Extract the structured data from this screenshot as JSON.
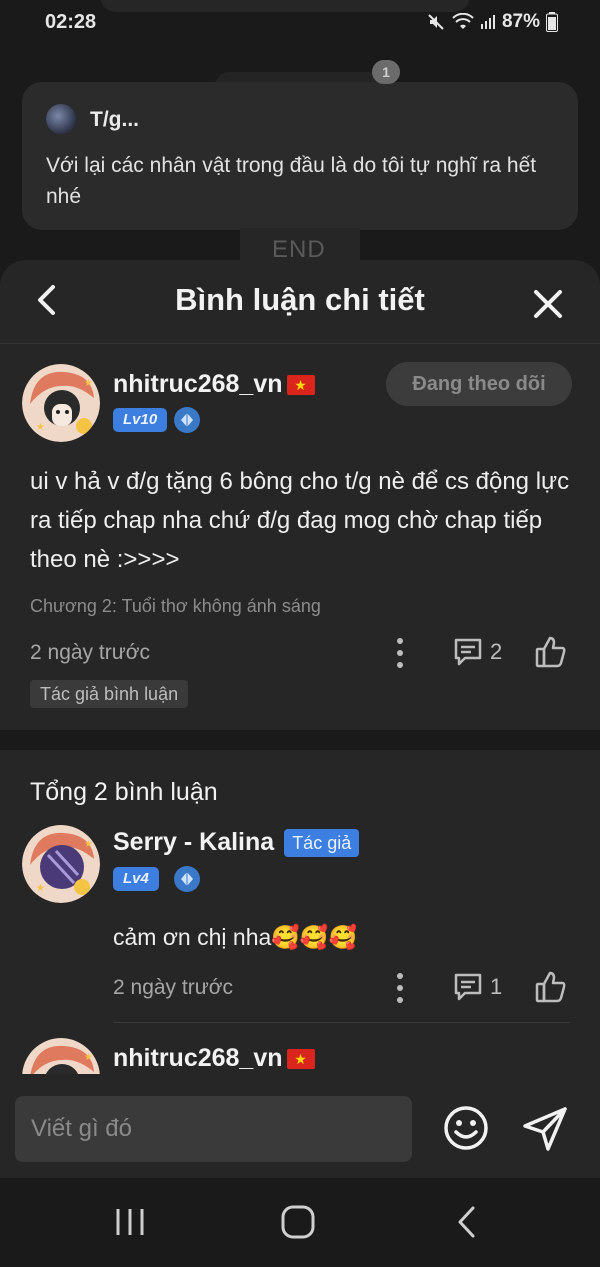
{
  "status": {
    "time": "02:28",
    "battery": "87%"
  },
  "background": {
    "notification_count": "1",
    "card_author": "T/g...",
    "card_text": "Với lại các nhân vật trong đầu là do tôi tự nghĩ ra hết nhé",
    "end_label": "END"
  },
  "header": {
    "title": "Bình luận chi tiết"
  },
  "main_comment": {
    "username": "nhitruc268_vn",
    "level": "Lv10",
    "follow_label": "Đang theo dõi",
    "text": "ui v hả v đ/g tặng 6 bông cho t/g nè để cs động lực ra tiếp chap nha chứ đ/g đag mog chờ chap tiếp theo nè :>>>>",
    "chapter": "Chương 2: Tuổi thơ không ánh sáng",
    "time": "2 ngày trước",
    "reply_count": "2",
    "author_tag": "Tác giả bình luận"
  },
  "replies": {
    "total_label": "Tổng 2 bình luận",
    "items": [
      {
        "username": "Serry - Kalina",
        "badge": "Tác giả",
        "level": "Lv4",
        "text": "cảm ơn chị nha🥰🥰🥰",
        "time": "2 ngày trước",
        "reply_count": "1"
      },
      {
        "username": "nhitruc268_vn"
      }
    ]
  },
  "input": {
    "placeholder": "Viết gì đó"
  },
  "colors": {
    "accent": "#3d7fe0",
    "sheet_bg": "#262626",
    "page_bg": "#1a1a1a"
  }
}
